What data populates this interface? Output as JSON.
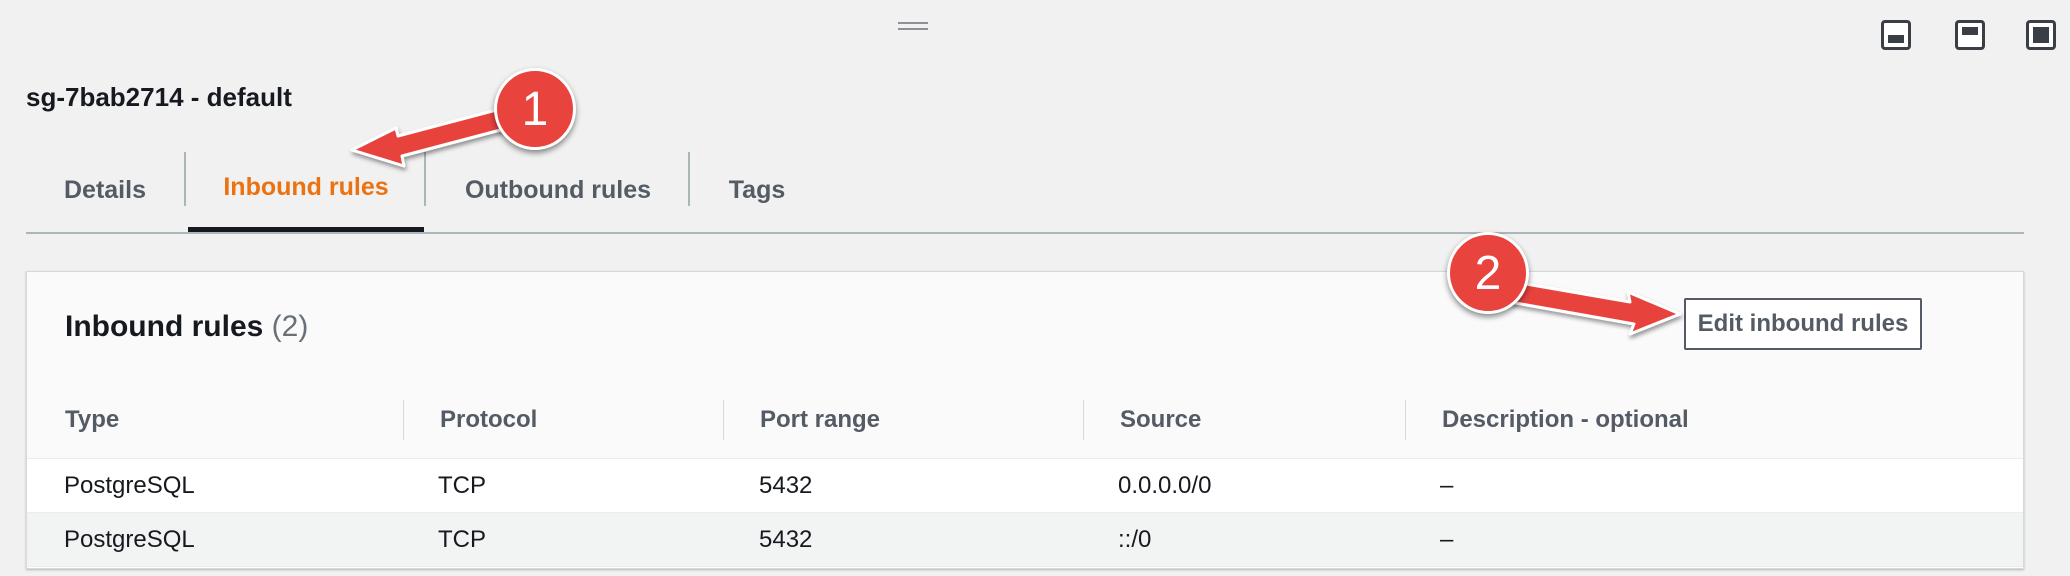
{
  "toolbar": {
    "drag_handle_icon": "drag-handle-icon",
    "layouts": [
      "layout-bottom-icon",
      "layout-side-icon",
      "layout-full-icon"
    ]
  },
  "security_group": {
    "title": "sg-7bab2714 - default"
  },
  "tabs": [
    {
      "label": "Details",
      "active": false
    },
    {
      "label": "Inbound rules",
      "active": true
    },
    {
      "label": "Outbound rules",
      "active": false
    },
    {
      "label": "Tags",
      "active": false
    }
  ],
  "panel": {
    "title": "Inbound rules",
    "count": "(2)",
    "edit_button": "Edit inbound rules"
  },
  "table": {
    "headers": [
      "Type",
      "Protocol",
      "Port range",
      "Source",
      "Description - optional"
    ],
    "rows": [
      [
        "PostgreSQL",
        "TCP",
        "5432",
        "0.0.0.0/0",
        "–"
      ],
      [
        "PostgreSQL",
        "TCP",
        "5432",
        "::/0",
        "–"
      ]
    ]
  },
  "annotations": {
    "callout_1": "1",
    "callout_2": "2",
    "color": "#e8433d"
  },
  "colors": {
    "active_tab": "#ec7211",
    "text": "#16191f",
    "muted": "#545b64"
  }
}
